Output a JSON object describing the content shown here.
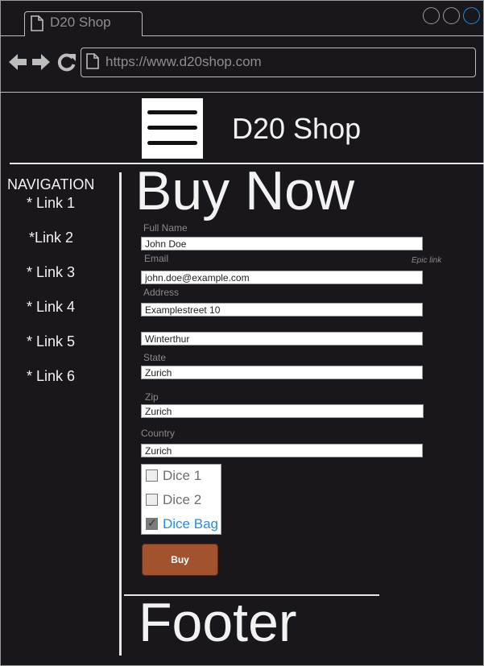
{
  "browser": {
    "tab_title": "D20 Shop",
    "url": "https://www.d20shop.com",
    "icons": [
      "document-icon",
      "back-arrow-icon",
      "forward-arrow-icon",
      "reload-icon"
    ],
    "window_button_accent": "#1b8ee0"
  },
  "header": {
    "site_title": "D20 Shop",
    "menu_icon": "hamburger-icon"
  },
  "sidebar": {
    "title": "NAVIGATION",
    "links": [
      "* Link 1",
      "*Link 2",
      "* Link 3",
      "* Link 4",
      "* Link 5",
      "* Link 6"
    ]
  },
  "main": {
    "title": "Buy Now",
    "epic_link": "Epic link",
    "form": {
      "full_name_label": "Full Name",
      "full_name_value": "John Doe",
      "email_label": "Email",
      "email_value": "john.doe@example.com",
      "address_label": "Address",
      "address_value": "Examplestreet 10",
      "city_value": "Winterthur",
      "state_label": "State",
      "state_value": "Zurich",
      "zip_label": "Zip",
      "zip_value": "Zurich",
      "country_label": "Country",
      "country_value": "Zurich"
    },
    "checkboxes": [
      {
        "label": "Dice 1",
        "checked": false
      },
      {
        "label": "Dice 2",
        "checked": false
      },
      {
        "label": "Dice Bag",
        "checked": true
      }
    ],
    "buy_button": "Buy",
    "buy_button_color": "#a2522c",
    "selected_color": "#1f8ee6"
  },
  "footer": {
    "text": "Footer"
  }
}
